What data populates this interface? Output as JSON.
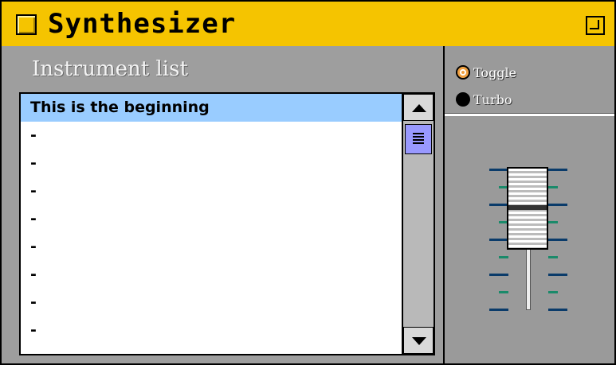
{
  "window": {
    "title": "Synthesizer"
  },
  "left": {
    "list_title": "Instrument list",
    "items": [
      {
        "label": "This is the beginning",
        "selected": true
      },
      {
        "label": "-"
      },
      {
        "label": "-"
      },
      {
        "label": "-"
      },
      {
        "label": "-"
      },
      {
        "label": "-"
      },
      {
        "label": "-"
      },
      {
        "label": "-"
      },
      {
        "label": "-"
      }
    ]
  },
  "right": {
    "options": [
      {
        "label": "Toggle",
        "selected": true
      },
      {
        "label": "Turbo",
        "selected": false
      }
    ]
  },
  "colors": {
    "titlebar": "#f5c400",
    "selection": "#99ccff",
    "scroll_thumb": "#9999ff",
    "radio_on": "#f0a040"
  }
}
